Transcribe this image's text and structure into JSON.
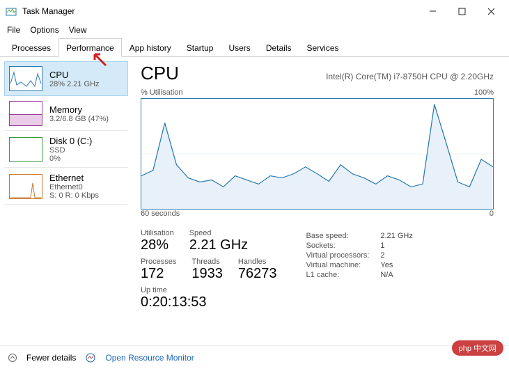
{
  "window": {
    "title": "Task Manager"
  },
  "menu": {
    "file": "File",
    "options": "Options",
    "view": "View"
  },
  "tabs": {
    "processes": "Processes",
    "performance": "Performance",
    "apphistory": "App history",
    "startup": "Startup",
    "users": "Users",
    "details": "Details",
    "services": "Services"
  },
  "sidebar": {
    "cpu": {
      "title": "CPU",
      "sub": "28% 2.21 GHz"
    },
    "mem": {
      "title": "Memory",
      "sub": "3.2/6.8 GB (47%)"
    },
    "disk": {
      "title": "Disk 0 (C:)",
      "sub": "SSD",
      "sub2": "0%"
    },
    "eth": {
      "title": "Ethernet",
      "sub": "Ethernet0",
      "sub2": "S: 0 R: 0 Kbps"
    }
  },
  "main": {
    "title": "CPU",
    "model": "Intel(R) Core(TM) i7-8750H CPU @ 2.20GHz",
    "chart": {
      "topLeft": "% Utilisation",
      "topRight": "100%",
      "bottomLeft": "60 seconds",
      "bottomRight": "0"
    },
    "stats": {
      "utilLabel": "Utilisation",
      "util": "28%",
      "speedLabel": "Speed",
      "speed": "2.21 GHz",
      "processesLabel": "Processes",
      "processes": "172",
      "threadsLabel": "Threads",
      "threads": "1933",
      "handlesLabel": "Handles",
      "handles": "76273",
      "uptimeLabel": "Up time",
      "uptime": "0:20:13:53"
    },
    "right": {
      "baseSpeedLabel": "Base speed:",
      "baseSpeed": "2.21 GHz",
      "socketsLabel": "Sockets:",
      "sockets": "1",
      "vprocLabel": "Virtual processors:",
      "vproc": "2",
      "vmLabel": "Virtual machine:",
      "vm": "Yes",
      "l1Label": "L1 cache:",
      "l1": "N/A"
    }
  },
  "footer": {
    "fewer": "Fewer details",
    "orm": "Open Resource Monitor"
  },
  "badge": "php 中文网",
  "chart_data": {
    "type": "line",
    "title": "% Utilisation",
    "xlabel": "60 seconds",
    "ylabel": "",
    "ylim": [
      0,
      100
    ],
    "x": [
      0,
      2,
      4,
      6,
      8,
      10,
      12,
      14,
      16,
      18,
      20,
      22,
      24,
      26,
      28,
      30,
      32,
      34,
      36,
      38,
      40,
      42,
      44,
      46,
      48,
      50,
      52,
      54,
      56,
      58,
      60
    ],
    "values": [
      30,
      35,
      78,
      40,
      28,
      24,
      26,
      20,
      30,
      26,
      22,
      30,
      28,
      32,
      38,
      32,
      25,
      40,
      32,
      28,
      22,
      30,
      26,
      20,
      22,
      95,
      60,
      24,
      20,
      45,
      38
    ]
  }
}
